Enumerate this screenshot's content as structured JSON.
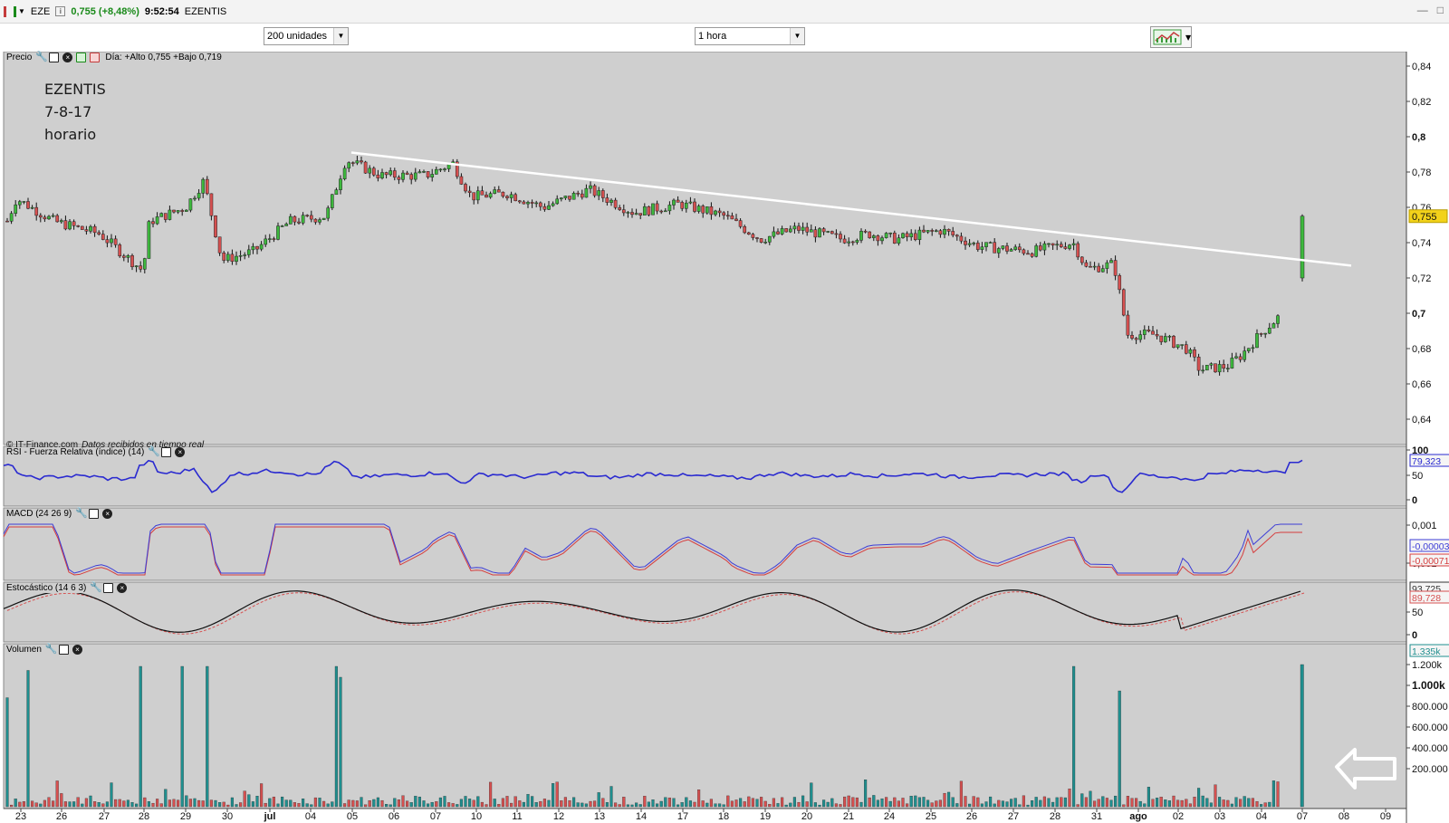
{
  "window": {
    "symbol": "EZE",
    "price_change": "0,755 (+8,48%)",
    "time": "9:52:54",
    "name": "EZENTIS"
  },
  "toolbar": {
    "units": "200 unidades",
    "interval": "1 hora"
  },
  "price_panel": {
    "title": "Precio",
    "day_info": "Día: +Alto 0,755 +Bajo 0,719",
    "notes": [
      "EZENTIS",
      "7-8-17",
      "horario"
    ],
    "y_ticks": [
      "0,84",
      "0,82",
      "0,8",
      "0,78",
      "0,76",
      "0,74",
      "0,72",
      "0,7",
      "0,68",
      "0,66",
      "0,64"
    ],
    "last_price_badge": "0,755",
    "credit": "© IT-Finance.com",
    "credit_note": "Datos recibidos en tiempo real"
  },
  "rsi_panel": {
    "title": "RSI - Fuerza Relativa (índice) (14)",
    "y_ticks": [
      "100",
      "50",
      "0"
    ],
    "value_badge": "79,323"
  },
  "macd_panel": {
    "title": "MACD (24 26 9)",
    "y_ticks": [
      "0,001",
      "0,001"
    ],
    "value_badges": [
      "-0,00003",
      "-0,00071"
    ]
  },
  "stoch_panel": {
    "title": "Estocástico (14 6 3)",
    "y_ticks": [
      "50",
      "0"
    ],
    "value_badges": [
      "93,725",
      "89,728"
    ]
  },
  "volume_panel": {
    "title": "Volumen",
    "y_ticks": [
      "1.200k",
      "1.000k",
      "800.000",
      "600.000",
      "400.000",
      "200.000"
    ],
    "value_badge": "1.335k"
  },
  "x_axis": {
    "labels": [
      "23",
      "26",
      "27",
      "28",
      "29",
      "30",
      "jul",
      "04",
      "05",
      "06",
      "07",
      "10",
      "11",
      "12",
      "13",
      "14",
      "17",
      "18",
      "19",
      "20",
      "21",
      "24",
      "25",
      "26",
      "27",
      "28",
      "31",
      "ago",
      "02",
      "03",
      "04",
      "07",
      "08",
      "09"
    ]
  },
  "colors": {
    "up": "#3db83d",
    "down": "#d65050",
    "volume_up": "#1f8f8f",
    "volume_down": "#d65050",
    "rsi": "#2a2ad0",
    "macd": "#3c3cd6",
    "macd_signal": "#d63c3c",
    "stoch_k": "#111111",
    "stoch_d": "#d65050",
    "panel_bg": "#cfcfcf",
    "trendline": "#ffffff"
  }
}
